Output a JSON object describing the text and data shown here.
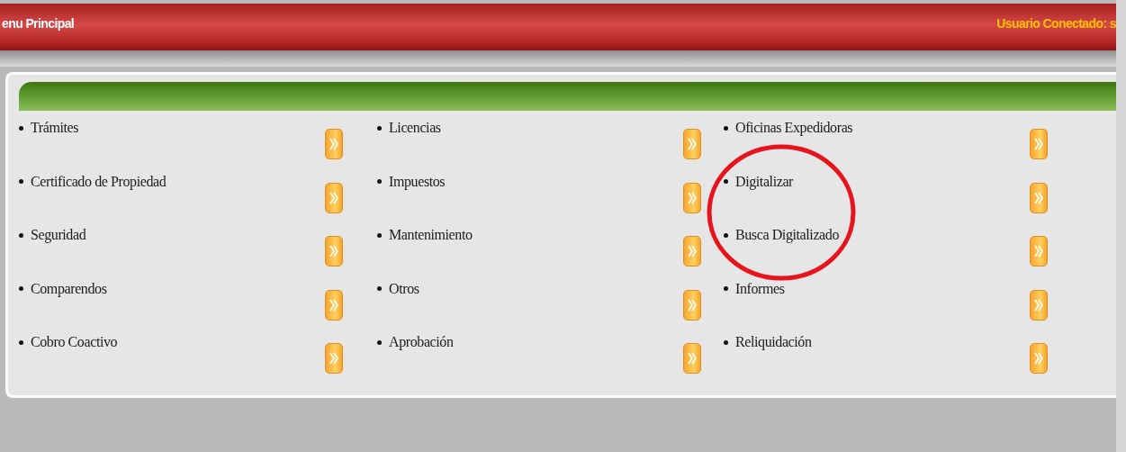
{
  "header": {
    "title": "enu Principal",
    "user_label": "Usuario Conectado: s"
  },
  "columns": [
    {
      "items": [
        {
          "label": "Trámites"
        },
        {
          "label": "Certificado de Propiedad"
        },
        {
          "label": "Seguridad"
        },
        {
          "label": "Comparendos"
        },
        {
          "label": "Cobro Coactivo"
        }
      ]
    },
    {
      "items": [
        {
          "label": "Licencias"
        },
        {
          "label": "Impuestos"
        },
        {
          "label": "Mantenimiento"
        },
        {
          "label": "Otros"
        },
        {
          "label": "Aprobación"
        }
      ]
    },
    {
      "items": [
        {
          "label": "Oficinas Expedidoras"
        },
        {
          "label": "Digitalizar"
        },
        {
          "label": "Busca Digitalizado"
        },
        {
          "label": "Informes"
        },
        {
          "label": "Reliquidación"
        }
      ]
    }
  ]
}
